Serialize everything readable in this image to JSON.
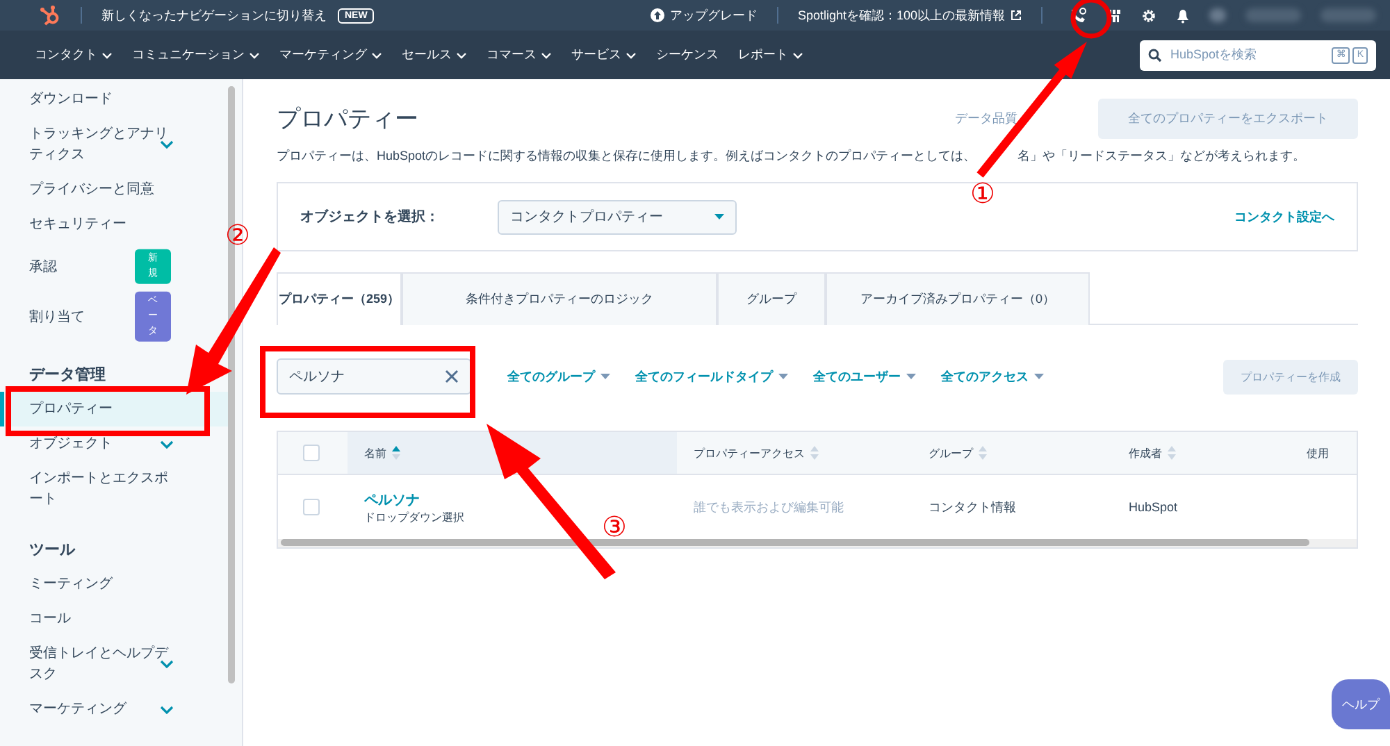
{
  "top_bar": {
    "switch_text": "新しくなったナビゲーションに切り替え",
    "new_badge": "NEW",
    "upgrade": "アップグレード",
    "spotlight": "Spotlightを確認：100以上の最新情報"
  },
  "nav": {
    "items": [
      {
        "label": "コンタクト",
        "dropdown": true
      },
      {
        "label": "コミュニケーション",
        "dropdown": true
      },
      {
        "label": "マーケティング",
        "dropdown": true
      },
      {
        "label": "セールス",
        "dropdown": true
      },
      {
        "label": "コマース",
        "dropdown": true
      },
      {
        "label": "サービス",
        "dropdown": true
      },
      {
        "label": "シーケンス",
        "dropdown": false
      },
      {
        "label": "レポート",
        "dropdown": true
      }
    ],
    "search": {
      "placeholder": "HubSpotを検索",
      "keys": [
        "⌘",
        "K"
      ]
    }
  },
  "sidebar": {
    "items": [
      {
        "kind": "link",
        "label": "ダウンロード",
        "selected": false
      },
      {
        "kind": "group",
        "label": "トラッキングとアナリティクス",
        "selected": false,
        "expanded": false
      },
      {
        "kind": "link",
        "label": "プライバシーと同意",
        "selected": false
      },
      {
        "kind": "link",
        "label": "セキュリティー",
        "selected": false
      },
      {
        "kind": "link",
        "label": "承認",
        "selected": false,
        "badge": "新規",
        "color": "#00bda5"
      },
      {
        "kind": "link",
        "label": "割り当て",
        "selected": false,
        "badge": "ベータ",
        "color": "#7078d6"
      },
      {
        "kind": "heading",
        "label": "データ管理"
      },
      {
        "kind": "link",
        "label": "プロパティー",
        "selected": true
      },
      {
        "kind": "group",
        "label": "オブジェクト",
        "selected": false,
        "expanded": false
      },
      {
        "kind": "link",
        "label": "インポートとエクスポート",
        "selected": false
      },
      {
        "kind": "heading",
        "label": "ツール"
      },
      {
        "kind": "link",
        "label": "ミーティング",
        "selected": false
      },
      {
        "kind": "link",
        "label": "コール",
        "selected": false
      },
      {
        "kind": "group",
        "label": "受信トレイとヘルプデスク",
        "selected": false,
        "expanded": false
      },
      {
        "kind": "group",
        "label": "マーケティング",
        "selected": false,
        "expanded": false
      }
    ]
  },
  "page": {
    "title": "プロパティー",
    "data_quality": "データ品質",
    "export_button": "全てのプロパティーをエクスポート",
    "description": [
      "プロパティーは、HubSpotのレコードに関する情報の収集と保存に使用します。例えばコンタクトのプロパティーとしては、",
      "名」や「リードステータス」などが考えられます。"
    ],
    "object_label": "オブジェクトを選択：",
    "object_value": "コンタクトプロパティー",
    "settings_link": "コンタクト設定へ",
    "tabs": [
      {
        "label": "プロパティー（259）",
        "selected": true
      },
      {
        "label": "条件付きプロパティーのロジック",
        "selected": false
      },
      {
        "label": "グループ",
        "selected": false
      },
      {
        "label": "アーカイブ済みプロパティー（0）",
        "selected": false
      }
    ],
    "search_value": "ペルソナ",
    "filters": [
      "全てのグループ",
      "全てのフィールドタイプ",
      "全てのユーザー",
      "全てのアクセス"
    ],
    "create_button": "プロパティーを作成",
    "table": {
      "columns": [
        {
          "label": "名前",
          "sorted": true
        },
        {
          "label": "プロパティーアクセス",
          "sorted": false
        },
        {
          "label": "グループ",
          "sorted": false
        },
        {
          "label": "作成者",
          "sorted": false
        },
        {
          "label": "使用",
          "sorted": false
        }
      ],
      "rows": [
        {
          "checked": false,
          "name": "ペルソナ",
          "type": "ドロップダウン選択",
          "access": "誰でも表示および編集可能",
          "group": "コンタクト情報",
          "creator": "HubSpot"
        }
      ]
    },
    "header_checked": false
  },
  "help_button": "ヘルプ",
  "annotations": [
    {
      "kind": "circle-arrow",
      "label": "①"
    },
    {
      "kind": "box-arrow",
      "label": "②"
    },
    {
      "kind": "box-arrow",
      "label": "③"
    }
  ]
}
